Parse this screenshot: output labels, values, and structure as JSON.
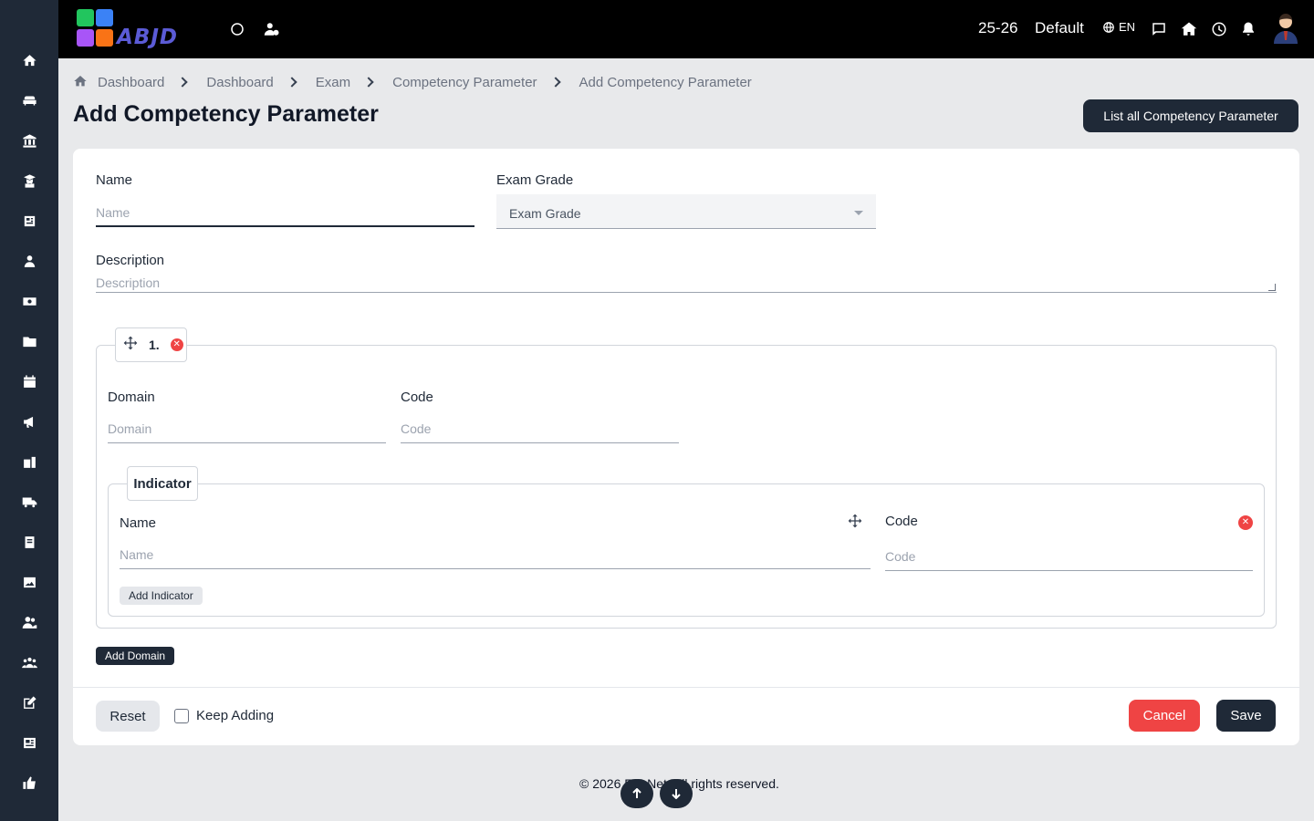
{
  "topbar": {
    "logo_text": "ABJD",
    "session": "25-26",
    "school": "Default",
    "language": "EN"
  },
  "breadcrumb": [
    "Dashboard",
    "Dashboard",
    "Exam",
    "Competency Parameter",
    "Add Competency Parameter"
  ],
  "page": {
    "title": "Add Competency Parameter",
    "list_button": "List all Competency Parameter"
  },
  "form": {
    "name_label": "Name",
    "name_placeholder": "Name",
    "exam_grade_label": "Exam Grade",
    "exam_grade_value": "Exam Grade",
    "description_label": "Description",
    "description_placeholder": "Description",
    "domain_block": {
      "number": "1.",
      "domain_label": "Domain",
      "domain_placeholder": "Domain",
      "code_label": "Code",
      "code_placeholder": "Code",
      "indicator": {
        "legend": "Indicator",
        "name_label": "Name",
        "name_placeholder": "Name",
        "code_label": "Code",
        "code_placeholder": "Code",
        "add_button": "Add Indicator"
      }
    },
    "add_domain_button": "Add Domain",
    "reset_button": "Reset",
    "keep_adding_label": "Keep Adding",
    "keep_adding_checked": false,
    "cancel_button": "Cancel",
    "save_button": "Save"
  },
  "footer": {
    "text": "© 2026 EduNet. All rights reserved."
  },
  "colors": {
    "sidebar_bg": "#1f2937",
    "topbar_bg": "#000000",
    "primary_button": "#1f2937",
    "danger": "#ef4444",
    "page_bg": "#e8e9eb"
  },
  "sidebar_icons": [
    "home-icon",
    "sofa-icon",
    "institution-icon",
    "graduate-icon",
    "newspaper-icon",
    "user-icon",
    "money-icon",
    "folder-icon",
    "calendar-icon",
    "megaphone-icon",
    "building-icon",
    "truck-icon",
    "book-icon",
    "image-icon",
    "users-icon",
    "group-icon",
    "edit-icon",
    "news-icon",
    "thumbs-up-icon"
  ]
}
